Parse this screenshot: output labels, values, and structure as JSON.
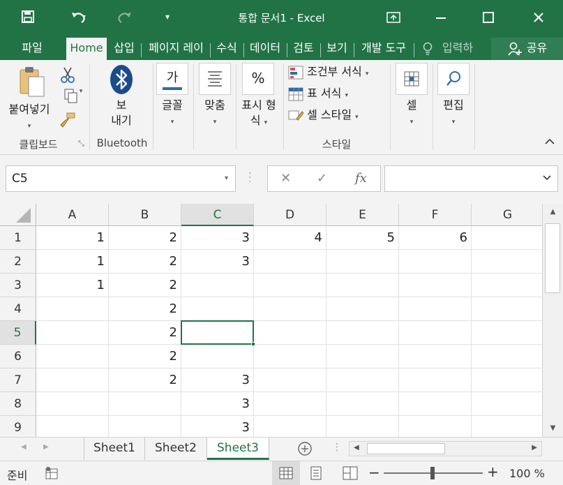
{
  "window": {
    "title": "통합 문서1 - Excel",
    "accent": "#217346"
  },
  "quick_access": {
    "save_icon": "save-icon",
    "undo_icon": "undo-icon",
    "redo_icon": "redo-icon",
    "customize_icon": "customize-qat-icon"
  },
  "tabs": {
    "file": "파일",
    "home": "Home",
    "insert": "삽입",
    "page_layout": "페이지 레이",
    "formulas": "수식",
    "data": "데이터",
    "review": "검토",
    "view": "보기",
    "developer": "개발 도구",
    "tell_me": "입력하",
    "share": "공유"
  },
  "ribbon": {
    "paste": "붙여넣기",
    "clipboard_group": "클립보드",
    "bluetooth_send_1": "보",
    "bluetooth_send_2": "내기",
    "bluetooth_group": "Bluetooth",
    "font": "글꼴",
    "font_icon_text": "가",
    "alignment": "맞춤",
    "number_format_1": "표시 형",
    "number_format_2": "식",
    "number_icon_text": "%",
    "conditional_format": "조건부 서식",
    "format_table": "표 서식",
    "cell_styles": "셀 스타일",
    "styles_group": "스타일",
    "cells": "셀",
    "editing": "편집"
  },
  "formula_bar": {
    "name_box": "C5",
    "cancel": "✕",
    "enter": "✓",
    "fx": "fx",
    "content": ""
  },
  "grid": {
    "columns": [
      "A",
      "B",
      "C",
      "D",
      "E",
      "F",
      "G"
    ],
    "rows": [
      "1",
      "2",
      "3",
      "4",
      "5",
      "6",
      "7",
      "8",
      "9"
    ],
    "cells": [
      [
        "1",
        "2",
        "3",
        "4",
        "5",
        "6",
        ""
      ],
      [
        "1",
        "2",
        "3",
        "",
        "",
        "",
        ""
      ],
      [
        "1",
        "2",
        "",
        "",
        "",
        "",
        ""
      ],
      [
        "",
        "2",
        "",
        "",
        "",
        "",
        ""
      ],
      [
        "",
        "2",
        "",
        "",
        "",
        "",
        ""
      ],
      [
        "",
        "2",
        "",
        "",
        "",
        "",
        ""
      ],
      [
        "",
        "2",
        "3",
        "",
        "",
        "",
        ""
      ],
      [
        "",
        "",
        "3",
        "",
        "",
        "",
        ""
      ],
      [
        "",
        "",
        "3",
        "",
        "",
        "",
        ""
      ]
    ],
    "active_cell": "C5"
  },
  "sheets": {
    "tab1": "Sheet1",
    "tab2": "Sheet2",
    "tab3": "Sheet3",
    "active": "Sheet3"
  },
  "status": {
    "ready": "준비",
    "zoom": "100 %"
  }
}
